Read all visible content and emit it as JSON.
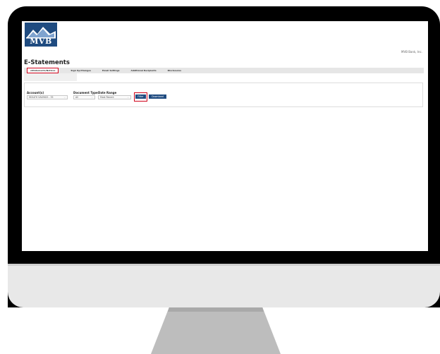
{
  "header": {
    "logo_text": "MVB",
    "bank_name": "MVB Bank, Inc."
  },
  "page": {
    "title": "E-Statements"
  },
  "tabs": [
    {
      "label": "eStatements/Notices",
      "active": true
    },
    {
      "label": "Sign Up/Changes",
      "active": false
    },
    {
      "label": "Email Settings",
      "active": false
    },
    {
      "label": "Additional Recipients",
      "active": false
    },
    {
      "label": "Disclosures",
      "active": false
    }
  ],
  "filters": {
    "account_label": "Account(s)",
    "account_value": "HEALTH SAVINGS - 35",
    "doc_type_label": "Document Type",
    "doc_type_value": "All",
    "date_range_label": "Date Range",
    "date_range_value": "Most Recent",
    "filter_button": "Filter",
    "download_button": "Download"
  },
  "colors": {
    "brand_blue": "#1f4b80",
    "highlight_red": "#d0021b"
  }
}
